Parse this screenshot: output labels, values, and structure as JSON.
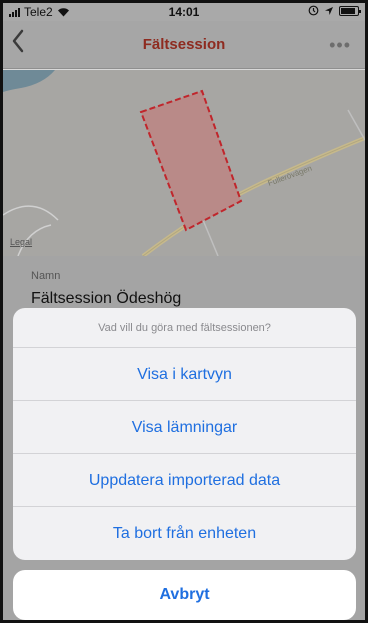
{
  "status_bar": {
    "carrier": "Tele2",
    "time": "14:01"
  },
  "nav": {
    "back_icon": "chevron-left-icon",
    "title": "Fältsession",
    "more_label": "•••"
  },
  "map": {
    "road_label": "Fullerövägen",
    "legal_label": "Legal"
  },
  "session": {
    "name_label": "Namn",
    "name_value": "Fältsession Ödeshög"
  },
  "action_sheet": {
    "title": "Vad vill du göra med fältsessionen?",
    "actions": [
      {
        "label": "Visa i kartvyn"
      },
      {
        "label": "Visa lämningar"
      },
      {
        "label": "Uppdatera importerad data"
      },
      {
        "label": "Ta bort från enheten"
      }
    ],
    "cancel_label": "Avbryt"
  },
  "colors": {
    "accent": "#1f6fe0",
    "title": "#8e2b20",
    "polygon": "#c0262c"
  }
}
